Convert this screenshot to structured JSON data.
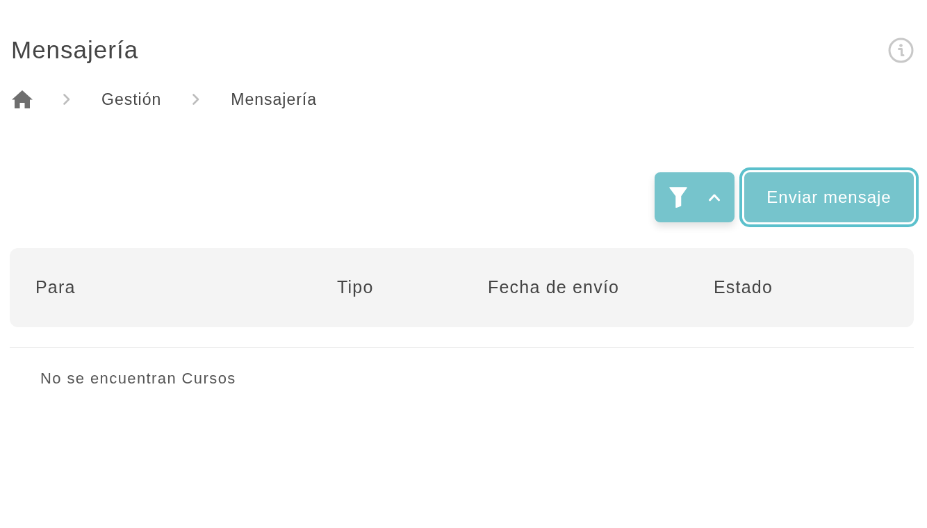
{
  "page": {
    "title": "Mensajería"
  },
  "breadcrumb": {
    "items": [
      {
        "label": "Gestión"
      },
      {
        "label": "Mensajería"
      }
    ]
  },
  "toolbar": {
    "filter_toggle": {
      "expanded": true
    },
    "send_button": {
      "label": "Enviar mensaje",
      "focused": true
    }
  },
  "table": {
    "columns": [
      "Para",
      "Tipo",
      "Fecha de envío",
      "Estado"
    ],
    "empty_message": "No se encuentran Cursos"
  }
}
